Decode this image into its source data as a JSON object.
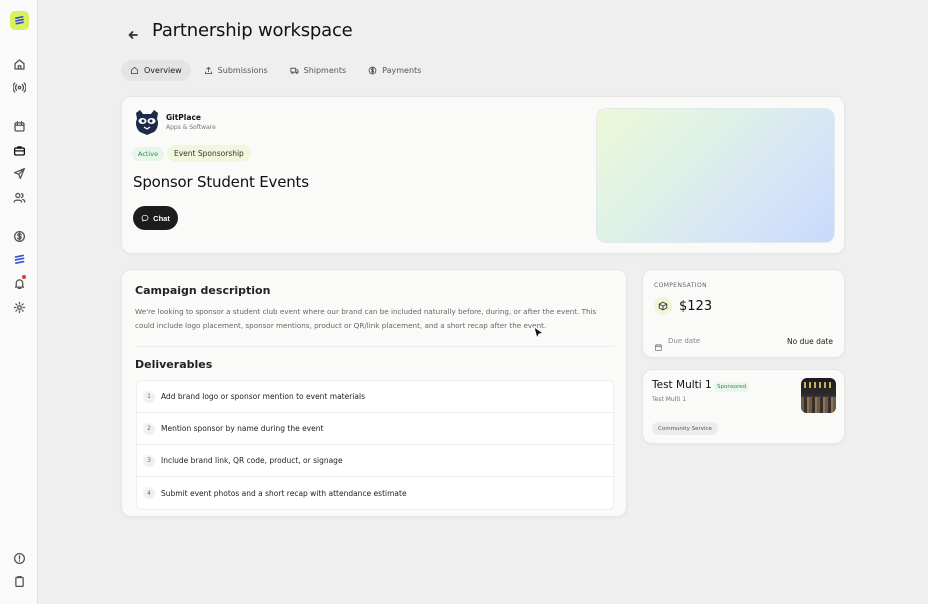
{
  "page": {
    "title": "Partnership workspace"
  },
  "tabs": [
    {
      "label": "Overview",
      "icon": "home-icon",
      "active": true
    },
    {
      "label": "Submissions",
      "icon": "upload-icon",
      "active": false
    },
    {
      "label": "Shipments",
      "icon": "truck-icon",
      "active": false
    },
    {
      "label": "Payments",
      "icon": "dollar-icon",
      "active": false
    }
  ],
  "sidebar": {
    "icons": [
      "home-icon",
      "broadcast-icon",
      "calendar-icon",
      "briefcase-icon",
      "send-icon",
      "users-icon",
      "dollar-icon",
      "brand-icon",
      "bell-icon",
      "settings-icon",
      "help-icon",
      "clipboard-icon"
    ],
    "active": "briefcase-icon"
  },
  "brand": {
    "name": "GitPlace",
    "category": "Apps & Software"
  },
  "campaign": {
    "status": "Active",
    "type": "Event Sponsorship",
    "title": "Sponsor Student Events",
    "chat_label": "Chat"
  },
  "description": {
    "heading": "Campaign description",
    "text": "We're looking to sponsor a student club event where our brand can be included naturally before, during, or after the event. This could include logo placement, sponsor mentions, product or QR/link placement, and a short recap after the event."
  },
  "deliverables": {
    "heading": "Deliverables",
    "items": [
      {
        "num": "1",
        "text": "Add brand logo or sponsor mention to event materials"
      },
      {
        "num": "2",
        "text": "Mention sponsor by name during the event"
      },
      {
        "num": "3",
        "text": "Include brand link, QR code, product, or signage"
      },
      {
        "num": "4",
        "text": "Submit event photos and a short recap with attendance estimate"
      }
    ]
  },
  "compensation": {
    "label": "COMPENSATION",
    "amount": "$123",
    "due_label": "Due date",
    "due_value": "No due date"
  },
  "club": {
    "name": "Test Multi 1",
    "badge": "Sponsored",
    "subtitle": "Test Multi 1",
    "tag": "Community Service"
  },
  "colors": {
    "accent": "#d9f25c",
    "active_green": "#2e8b4a",
    "dark_button": "#1c1c1c"
  }
}
